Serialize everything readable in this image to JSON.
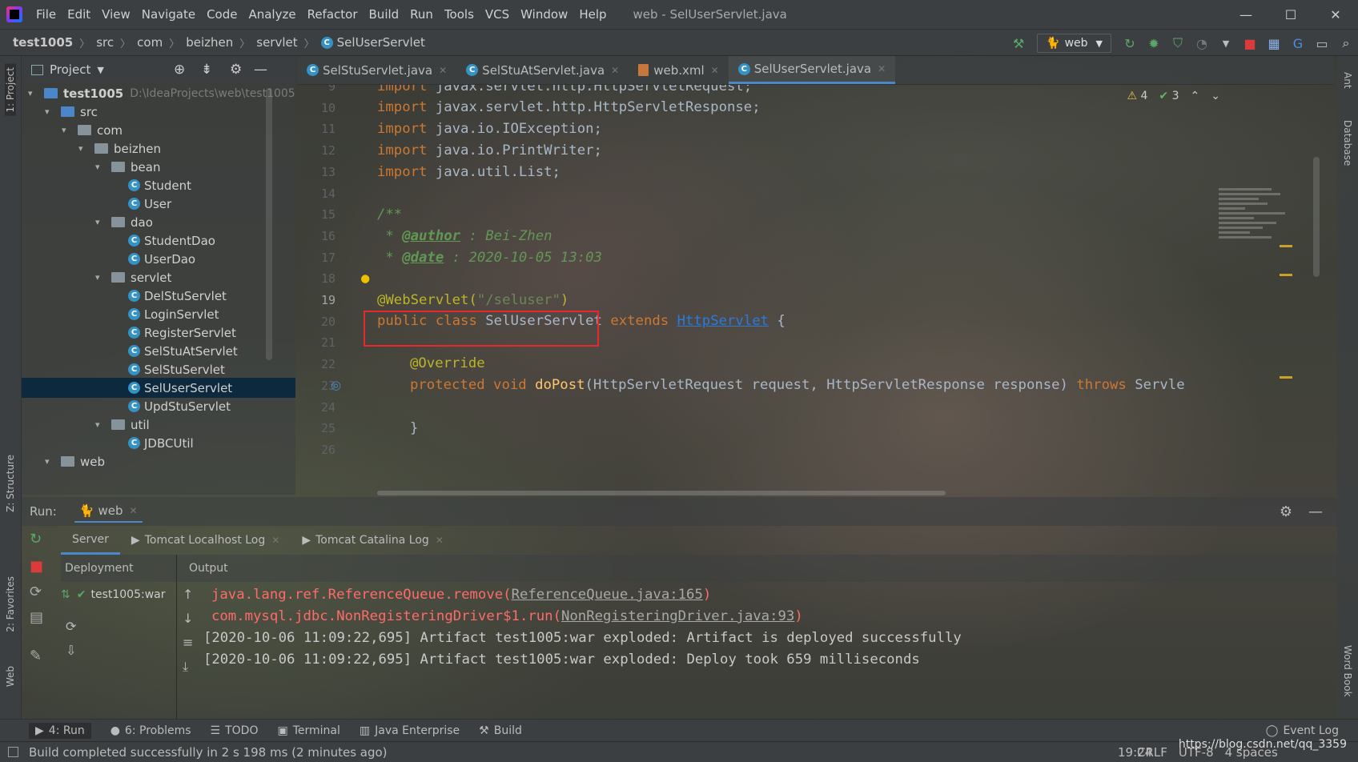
{
  "window": {
    "title": "web - SelUserServlet.java",
    "minimize": "—",
    "maximize": "☐",
    "close": "✕"
  },
  "menu": [
    "File",
    "Edit",
    "View",
    "Navigate",
    "Code",
    "Analyze",
    "Refactor",
    "Build",
    "Run",
    "Tools",
    "VCS",
    "Window",
    "Help"
  ],
  "breadcrumb": [
    "test1005",
    "src",
    "com",
    "beizhen",
    "servlet",
    "SelUserServlet"
  ],
  "run_config": "web",
  "project_panel": {
    "title": "Project",
    "stripe_label": "1: Project"
  },
  "tree": [
    {
      "label": "test1005",
      "path": "D:\\IdeaProjects\\web\\test1005",
      "depth": 0,
      "type": "module",
      "open": true
    },
    {
      "label": "src",
      "depth": 1,
      "type": "src",
      "open": true
    },
    {
      "label": "com",
      "depth": 2,
      "type": "pkg",
      "open": true
    },
    {
      "label": "beizhen",
      "depth": 3,
      "type": "pkg",
      "open": true
    },
    {
      "label": "bean",
      "depth": 4,
      "type": "pkg",
      "open": true
    },
    {
      "label": "Student",
      "depth": 5,
      "type": "class"
    },
    {
      "label": "User",
      "depth": 5,
      "type": "class"
    },
    {
      "label": "dao",
      "depth": 4,
      "type": "pkg",
      "open": true
    },
    {
      "label": "StudentDao",
      "depth": 5,
      "type": "class"
    },
    {
      "label": "UserDao",
      "depth": 5,
      "type": "class"
    },
    {
      "label": "servlet",
      "depth": 4,
      "type": "pkg",
      "open": true
    },
    {
      "label": "DelStuServlet",
      "depth": 5,
      "type": "class"
    },
    {
      "label": "LoginServlet",
      "depth": 5,
      "type": "class"
    },
    {
      "label": "RegisterServlet",
      "depth": 5,
      "type": "class"
    },
    {
      "label": "SelStuAtServlet",
      "depth": 5,
      "type": "class"
    },
    {
      "label": "SelStuServlet",
      "depth": 5,
      "type": "class"
    },
    {
      "label": "SelUserServlet",
      "depth": 5,
      "type": "class",
      "selected": true
    },
    {
      "label": "UpdStuServlet",
      "depth": 5,
      "type": "class"
    },
    {
      "label": "util",
      "depth": 4,
      "type": "pkg",
      "open": true
    },
    {
      "label": "JDBCUtil",
      "depth": 5,
      "type": "class"
    },
    {
      "label": "web",
      "depth": 1,
      "type": "folder",
      "open": true
    }
  ],
  "tabs": [
    {
      "label": "SelStuServlet.java",
      "icon": "class"
    },
    {
      "label": "SelStuAtServlet.java",
      "icon": "class"
    },
    {
      "label": "web.xml",
      "icon": "xml"
    },
    {
      "label": "SelUserServlet.java",
      "icon": "class",
      "active": true
    }
  ],
  "inspections": {
    "warnings": "4",
    "weak": "3"
  },
  "line_numbers": [
    "9",
    "10",
    "11",
    "12",
    "13",
    "14",
    "15",
    "16",
    "17",
    "18",
    "19",
    "20",
    "21",
    "22",
    "23",
    "24",
    "25",
    "26"
  ],
  "code": {
    "l9": "javax.servlet.http.HttpServletRequest;",
    "l10": "javax.servlet.http.HttpServletResponse;",
    "l11": "java.io.IOException;",
    "l12": "java.io.PrintWriter;",
    "l13": "java.util.List;",
    "import_kw": "import",
    "l15": "/**",
    "l16_tag": "@author",
    "l16_text": " : Bei-Zhen",
    "l17_tag": "@date",
    "l17_text": " : 2020-10-05 13:03",
    "l18": " */",
    "l19_ann": "@WebServlet(",
    "l19_str": "\"/seluser\"",
    "l19_end": ")",
    "l20_kw": "public class",
    "l20_name": " SelUserServlet ",
    "l20_ext": "extends",
    "l20_link": "HttpServlet",
    "l20_brace": " {",
    "l22": "@Override",
    "l23_kw": "protected void",
    "l23_fn": "doPost",
    "l23_params": "(HttpServletRequest request, HttpServletResponse response) ",
    "l23_throws": "throws",
    "l23_rest": " Servle",
    "l25": "}"
  },
  "run": {
    "label": "Run:",
    "config": "web",
    "tabs": [
      "Server",
      "Tomcat Localhost Log",
      "Tomcat Catalina Log"
    ],
    "deployment_header": "Deployment",
    "output_header": "Output",
    "deployment_item": "test1005:war",
    "output": [
      {
        "pre": "java.lang.ref.ReferenceQueue.remove(",
        "link": "ReferenceQueue.java:165",
        "post": ")",
        "error": true
      },
      {
        "pre": "com.mysql.jdbc.NonRegisteringDriver$1.run(",
        "link": "NonRegisteringDriver.java:93",
        "post": ")",
        "error": true
      },
      {
        "pre": "[2020-10-06 11:09:22,695] Artifact test1005:war exploded: Artifact is deployed successfully",
        "error": false
      },
      {
        "pre": "[2020-10-06 11:09:22,695] Artifact test1005:war exploded: Deploy took 659 milliseconds",
        "error": false
      }
    ]
  },
  "left_stripe": [
    "1: Project",
    "Z: Structure",
    "2: Favorites",
    "Web"
  ],
  "right_stripe": [
    "Ant",
    "Database",
    "Word Book"
  ],
  "toolwindows": [
    "4: Run",
    "6: Problems",
    "TODO",
    "Terminal",
    "Java Enterprise",
    "Build"
  ],
  "event_log": "Event Log",
  "status": {
    "message": "Build completed successfully in 2 s 198 ms (2 minutes ago)",
    "position": "19:24",
    "line_sep": "CRLF",
    "encoding": "UTF-8",
    "indent": "4 spaces"
  },
  "watermark": "https://blog.csdn.net/qq_3359"
}
